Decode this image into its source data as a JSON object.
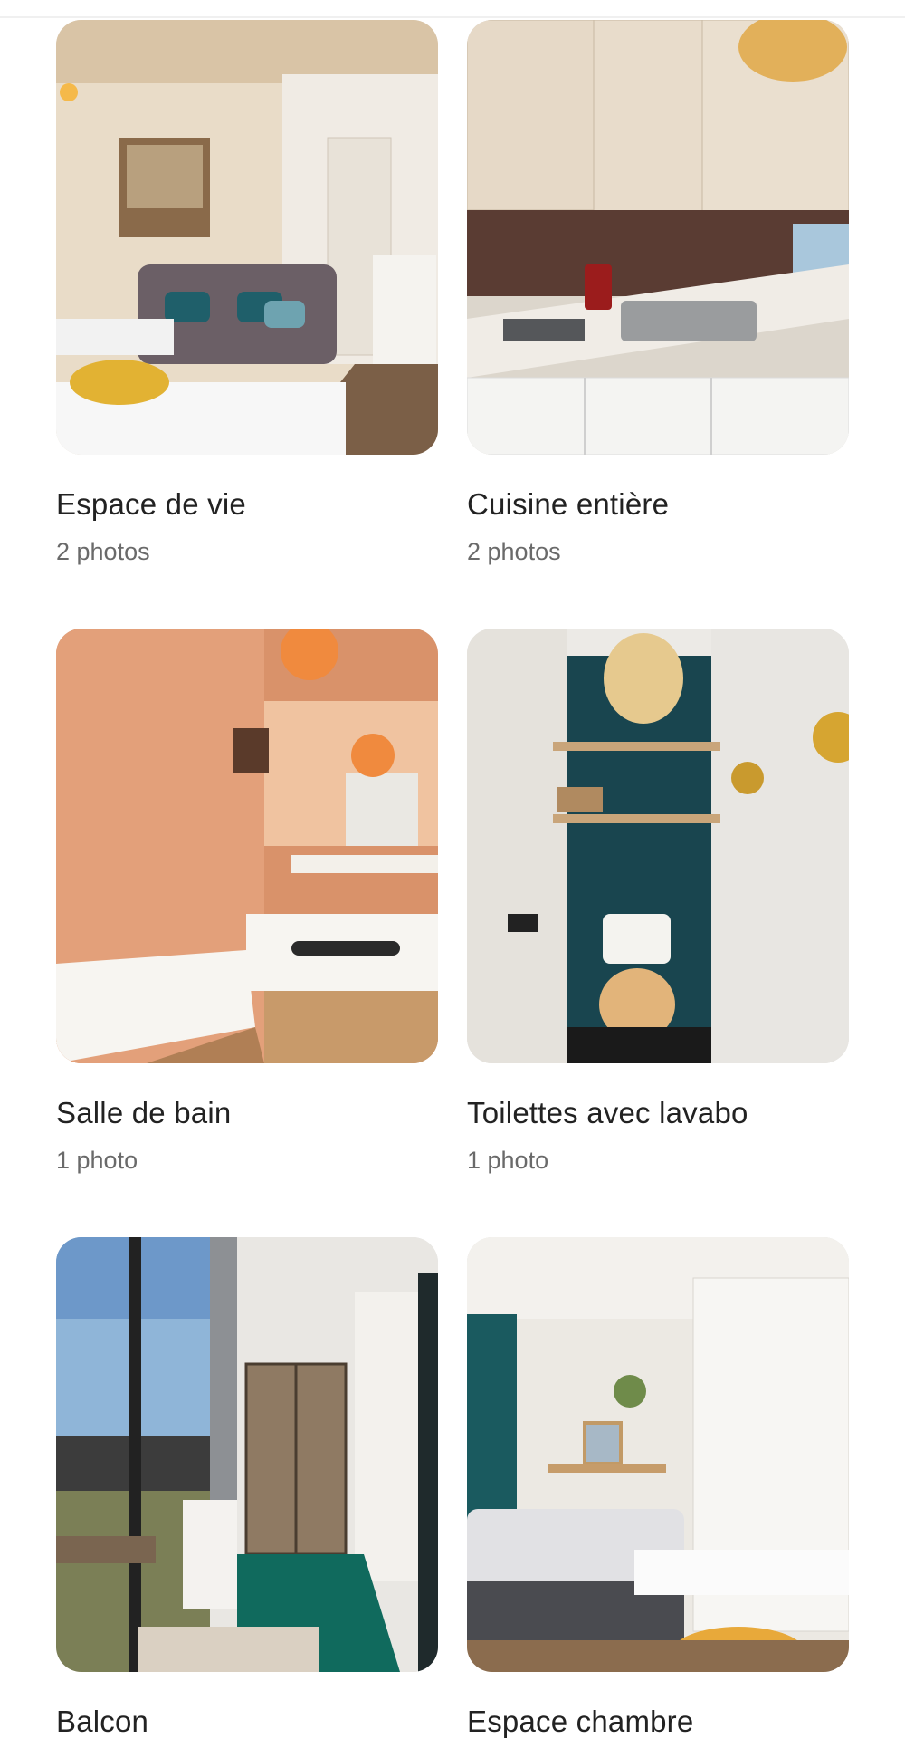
{
  "rooms": [
    {
      "title": "Espace de vie",
      "count": "2 photos",
      "image": "living-room-photo"
    },
    {
      "title": "Cuisine entière",
      "count": "2 photos",
      "image": "kitchen-photo"
    },
    {
      "title": "Salle de bain",
      "count": "1 photo",
      "image": "bathroom-photo"
    },
    {
      "title": "Toilettes avec lavabo",
      "count": "1 photo",
      "image": "toilet-photo"
    },
    {
      "title": "Balcon",
      "count": "",
      "image": "balcony-photo"
    },
    {
      "title": "Espace chambre",
      "count": "",
      "image": "bedroom-photo"
    }
  ],
  "colors": {
    "title": "#222222",
    "subtitle": "#6a6a6a",
    "divider": "#f0f0f0"
  }
}
